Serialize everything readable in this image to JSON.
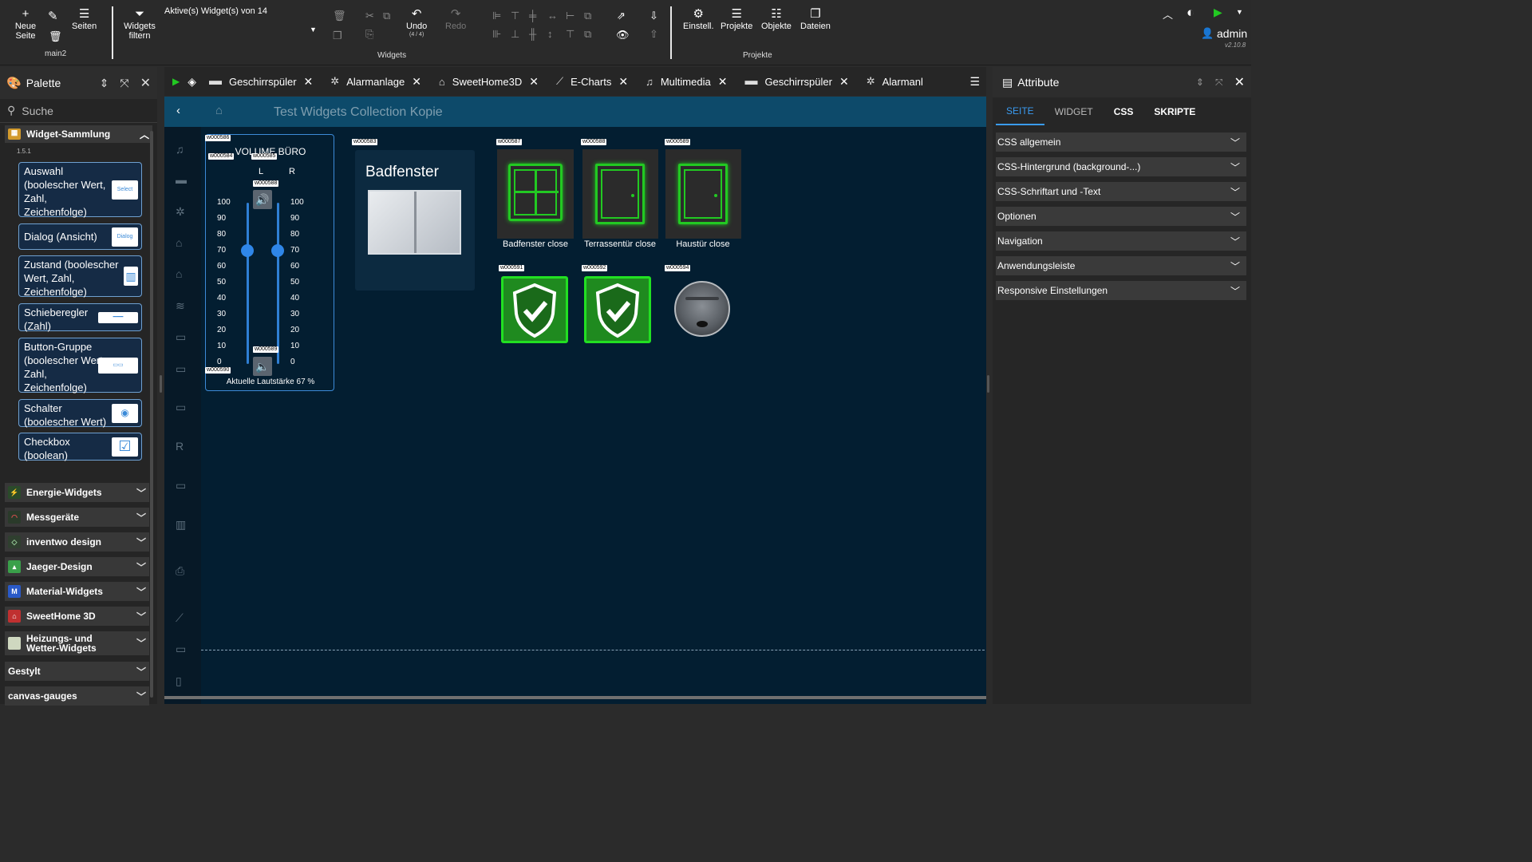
{
  "toolbar": {
    "new_page": "Neue Seite",
    "pages": "Seiten",
    "page_name": "main2",
    "filter": "Widgets filtern",
    "active_widgets": "Aktive(s) Widget(s) von 14",
    "undo": "Undo",
    "undo_count": "(4 / 4)",
    "redo": "Redo",
    "group_widgets": "Widgets",
    "settings": "Einstell.",
    "projects": "Projekte",
    "objects": "Objekte",
    "files": "Dateien",
    "group_projects": "Projekte",
    "user": "admin",
    "version": "v2.10.8"
  },
  "palette": {
    "title": "Palette",
    "search_placeholder": "Suche",
    "open_category": "Widget-Sammlung",
    "version": "1.5.1",
    "widgets": [
      {
        "label": "Auswahl (boolescher Wert, Zahl, Zeichenfolge)",
        "preview": "Select"
      },
      {
        "label": "Dialog (Ansicht)",
        "preview": "Dialog"
      },
      {
        "label": "Zustand (boolescher Wert, Zahl, Zeichenfolge)",
        "preview": "▥"
      },
      {
        "label": "Schieberegler (Zahl)",
        "preview": "━━━"
      },
      {
        "label": "Button-Gruppe (boolescher Wert, Zahl, Zeichenfolge)",
        "preview": "▭▭"
      },
      {
        "label": "Schalter (boolescher Wert)",
        "preview": "◉"
      },
      {
        "label": "Checkbox (boolean)",
        "preview": "☑"
      }
    ],
    "categories": [
      "Energie-Widgets",
      "Messgeräte",
      "inventwo design",
      "Jaeger-Design",
      "Material-Widgets",
      "SweetHome 3D",
      "Heizungs- und Wetter-Widgets",
      "Gestylt",
      "canvas-gauges"
    ],
    "category_colors": [
      "#2a8c3a",
      "#2a6a3a",
      "#3a7a3a",
      "#3aa04a",
      "#2a5ac8",
      "#c03030",
      "#cfd8c0",
      "",
      ""
    ]
  },
  "tabs": [
    {
      "label": "Geschirrspüler",
      "icon": "dishwasher-icon"
    },
    {
      "label": "Alarmanlage",
      "icon": "alarm-icon"
    },
    {
      "label": "SweetHome3D",
      "icon": "house-icon"
    },
    {
      "label": "E-Charts",
      "icon": "chart-icon"
    },
    {
      "label": "Multimedia",
      "icon": "music-icon"
    },
    {
      "label": "Geschirrspüler",
      "icon": "dishwasher-icon"
    },
    {
      "label": "Alarmanl",
      "icon": "alarm-icon"
    }
  ],
  "canvas": {
    "title": "Test Widgets Collection Kopie",
    "volume": {
      "title": "VOLUME BÜRO",
      "left": "L",
      "right": "R",
      "scale": [
        "100",
        "90",
        "80",
        "70",
        "60",
        "50",
        "40",
        "30",
        "20",
        "10",
        "0"
      ],
      "value_left": 70,
      "value_right": 70,
      "status": "Aktuelle Lautstärke 67 %"
    },
    "window_card": {
      "title": "Badfenster"
    },
    "contacts": [
      {
        "label": "Badfenster close"
      },
      {
        "label": "Terrassentür close"
      },
      {
        "label": "Haustür close"
      }
    ],
    "widget_ids": [
      "w000586",
      "w000584",
      "w000585",
      "w000588",
      "w000589",
      "w000590",
      "w000583",
      "w000587",
      "w000588",
      "w000589",
      "w000591",
      "w000592",
      "w000594"
    ]
  },
  "attributes": {
    "title": "Attribute",
    "tabs": [
      "SEITE",
      "WIDGET",
      "CSS",
      "SKRIPTE"
    ],
    "sections": [
      "CSS allgemein",
      "CSS-Hintergrund (background-...)",
      "CSS-Schriftart und -Text",
      "Optionen",
      "Navigation",
      "Anwendungsleiste",
      "Responsive Einstellungen"
    ]
  },
  "colors": {
    "accent": "#3a9bf0",
    "canvas_bg": "#031e31",
    "header_bg": "#0d4a6a",
    "green": "#22c922"
  }
}
